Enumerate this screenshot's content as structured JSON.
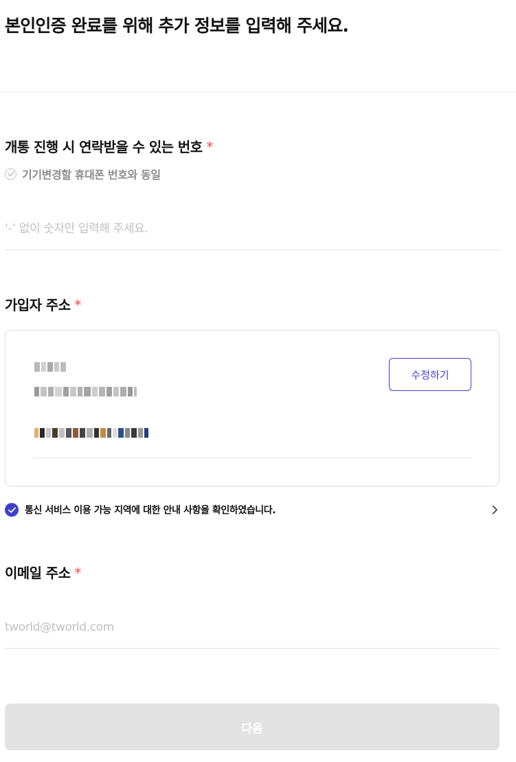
{
  "page_title": "본인인증 완료를 위해 추가 정보를 입력해 주세요.",
  "contact": {
    "label": "개통 진행 시 연락받을 수 있는 번호",
    "required_mark": "*",
    "same_as_device_label": "기기변경할 휴대폰 번호와 동일",
    "phone_placeholder": "‘-’ 없이 숫자만 입력해 주세요.",
    "phone_value": ""
  },
  "address": {
    "label": "가입자 주소",
    "required_mark": "*",
    "edit_label": "수정하기"
  },
  "service_notice": {
    "text": "통신 서비스 이용 가능 지역에 대한 안내 사항을 확인하였습니다.",
    "checked": true
  },
  "email": {
    "label": "이메일 주소",
    "required_mark": "*",
    "placeholder": "tworld@tworld.com",
    "value": ""
  },
  "next_button_label": "다음",
  "colors": {
    "accent": "#3d3fd0",
    "required": "#f04a4a",
    "disabled_button": "#e2e2e2"
  }
}
